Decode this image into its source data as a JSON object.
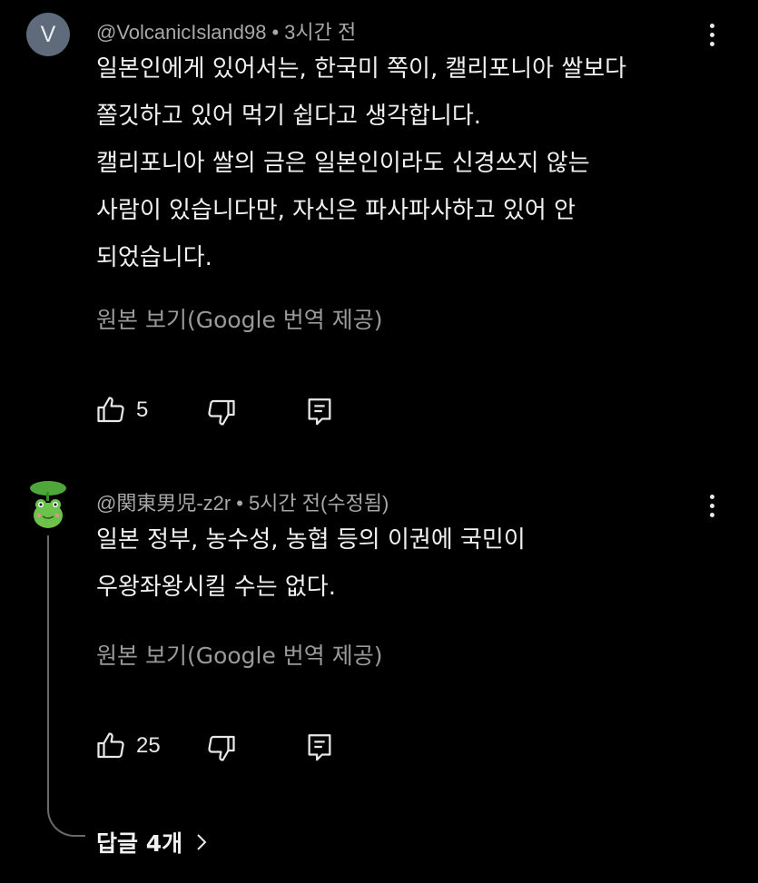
{
  "comment1": {
    "avatar_letter": "V",
    "author": "@VolcanicIsland98",
    "time": "3시간 전",
    "lines": [
      "일본인에게 있어서는, 한국미 쪽이, 캘리포니아 쌀보다",
      "쫄깃하고 있어 먹기 쉽다고 생각합니다.",
      "캘리포니아 쌀의 금은 일본인이라도 신경쓰지 않는",
      "사람이 있습니다만, 자신은 파사파사하고 있어 안",
      "되었습니다."
    ],
    "translate_label": "원본 보기(Google 번역 제공)",
    "likes": "5"
  },
  "comment2": {
    "author": "@関東男児-z2r",
    "time": "5시간 전(수정됨)",
    "lines": [
      "일본 정부, 농수성, 농협 등의 이권에 국민이",
      "우왕좌왕시킬 수는 없다."
    ],
    "translate_label": "원본 보기(Google 번역 제공)",
    "likes": "25",
    "avatar_icon": "frog-avatar-icon"
  },
  "replies_label": "답글 4개",
  "colors": {
    "background": "#000000",
    "text": "#f1f1f1",
    "meta": "#a8a8a8",
    "avatar_bg": "#5f6b7a"
  },
  "icons": [
    "like-icon",
    "dislike-icon",
    "reply-icon",
    "more-vert-icon",
    "chevron-right-icon"
  ]
}
